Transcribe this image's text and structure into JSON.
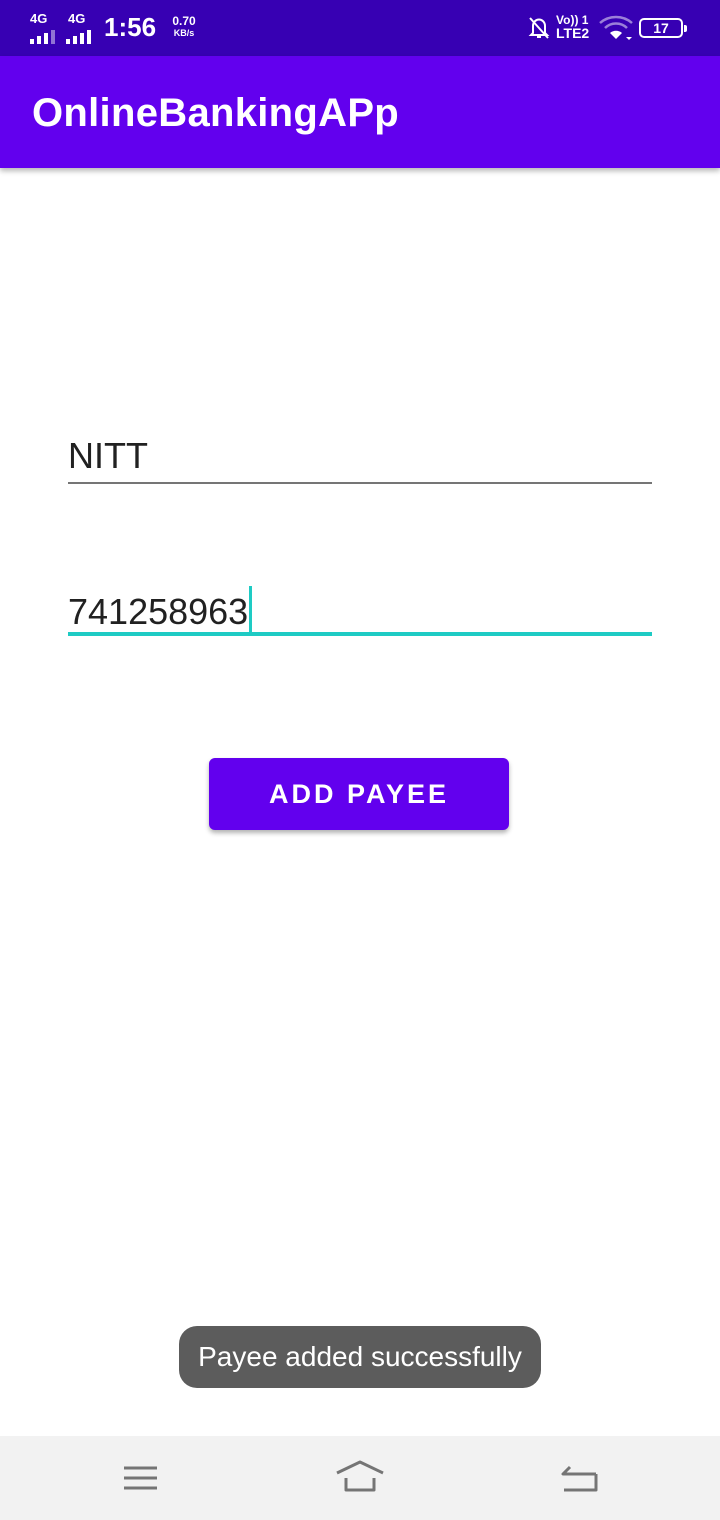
{
  "status_bar": {
    "network_1": "4G",
    "network_2": "4G",
    "time": "1:56",
    "speed_value": "0.70",
    "speed_unit": "KB/s",
    "volte_top": "Vo)) 1",
    "volte_bottom": "LTE2",
    "battery": "17",
    "icons": [
      "signal-icon",
      "signal-icon",
      "bell-off-icon",
      "wifi-icon",
      "battery-icon"
    ]
  },
  "app_bar": {
    "title": "OnlineBankingAPp",
    "color": "#6200ee"
  },
  "form": {
    "payee_name_value": "NITT",
    "account_number_value": "741258963",
    "accent_color": "#1ecbc4"
  },
  "button": {
    "label": "ADD PAYEE"
  },
  "toast": {
    "message": "Payee added successfully"
  },
  "nav_bar": {
    "icons": [
      "menu-icon",
      "home-icon",
      "back-icon"
    ]
  }
}
